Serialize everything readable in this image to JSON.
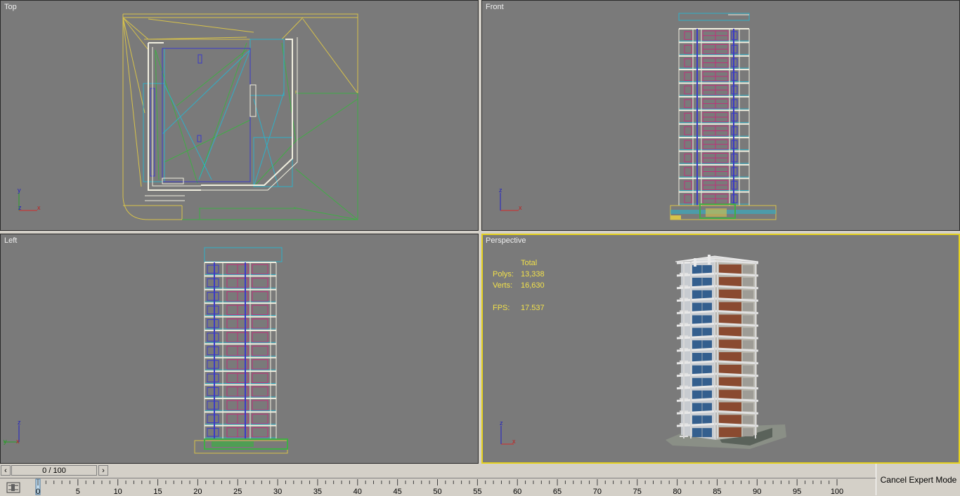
{
  "viewports": {
    "top": {
      "label": "Top"
    },
    "front": {
      "label": "Front"
    },
    "left": {
      "label": "Left"
    },
    "perspective": {
      "label": "Perspective",
      "stats": {
        "header": "Total",
        "polys_label": "Polys:",
        "polys_value": "13,338",
        "verts_label": "Verts:",
        "verts_value": "16,630",
        "fps_label": "FPS:",
        "fps_value": "17.537"
      }
    }
  },
  "axes": {
    "x": "x",
    "y": "y",
    "z": "z"
  },
  "timeline": {
    "frame_text": "0 / 100",
    "prev_icon": "chevron-left-icon",
    "next_icon": "chevron-right-icon",
    "progress": 0,
    "ticks": [
      "0",
      "5",
      "10",
      "15",
      "20",
      "25",
      "30",
      "35",
      "40",
      "45",
      "50",
      "55",
      "60",
      "65",
      "70",
      "75",
      "80",
      "85",
      "90",
      "95",
      "100"
    ]
  },
  "cancel_expert_mode": "Cancel Expert Mode",
  "colors": {
    "viewport_bg": "#7a7a7a",
    "active_border": "#e6d21e",
    "stats_text": "#f2e14a"
  }
}
